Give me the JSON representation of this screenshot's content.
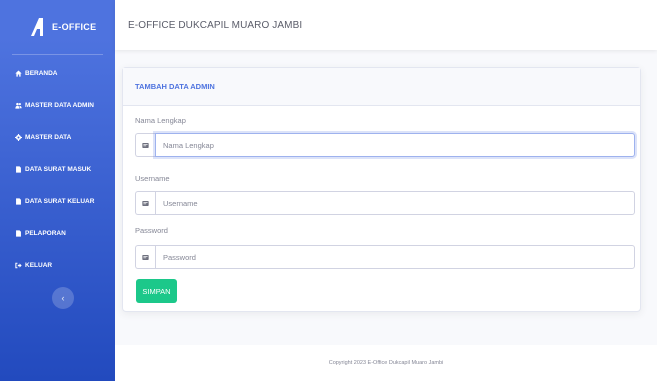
{
  "brand": {
    "name": "E-OFFICE",
    "logo_icon": "rocket-logo-icon"
  },
  "sidebar": {
    "items": [
      {
        "label": "BERANDA",
        "icon": "home-icon"
      },
      {
        "label": "MASTER DATA ADMIN",
        "icon": "users-icon"
      },
      {
        "label": "MASTER DATA",
        "icon": "gear-icon"
      },
      {
        "label": "DATA SURAT MASUK",
        "icon": "file-icon"
      },
      {
        "label": "DATA SURAT KELUAR",
        "icon": "file-icon"
      },
      {
        "label": "PELAPORAN",
        "icon": "file-icon"
      },
      {
        "label": "KELUAR",
        "icon": "sign-out-icon"
      }
    ],
    "toggle_glyph": "‹"
  },
  "topbar": {
    "title": "E-OFFICE DUKCAPIL MUARO JAMBI"
  },
  "form": {
    "card_title": "TAMBAH DATA ADMIN",
    "fields": [
      {
        "label": "Nama Lengkap",
        "placeholder": "Nama Lengkap",
        "value": ""
      },
      {
        "label": "Username",
        "placeholder": "Username",
        "value": ""
      },
      {
        "label": "Password",
        "placeholder": "Password",
        "value": ""
      }
    ],
    "submit_label": "SIMPAN"
  },
  "footer": {
    "copyright": "Copyright 2023 E-Office Dukcapil Muaro Jambi"
  },
  "colors": {
    "primary": "#4e73df",
    "success": "#1cc88a",
    "sidebar_dark": "#224abe"
  }
}
